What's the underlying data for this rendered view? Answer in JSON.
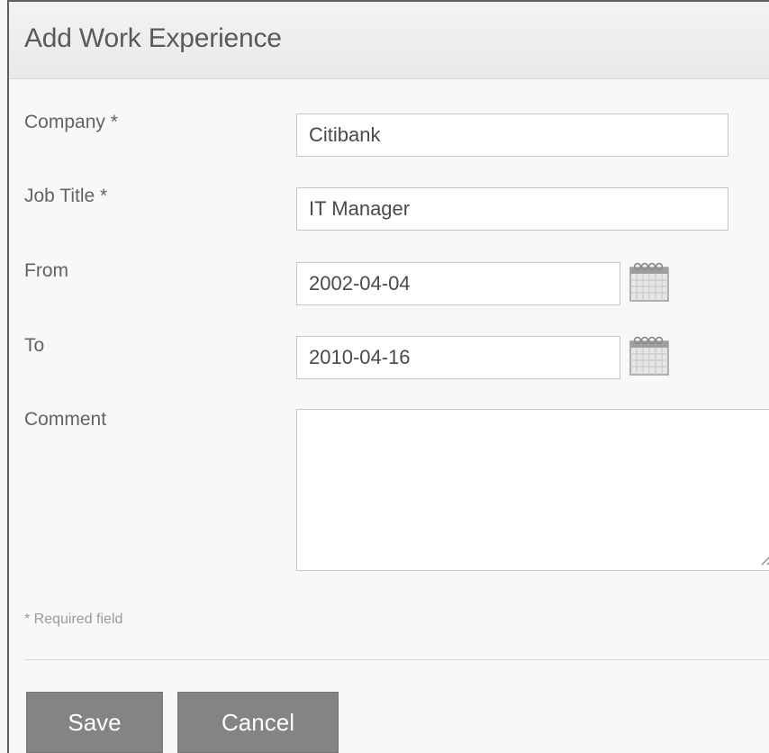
{
  "dialog": {
    "title": "Add Work Experience"
  },
  "form": {
    "company": {
      "label": "Company *",
      "value": "Citibank"
    },
    "job_title": {
      "label": "Job Title *",
      "value": "IT Manager"
    },
    "from": {
      "label": "From",
      "value": "2002-04-04",
      "icon": "calendar-icon"
    },
    "to": {
      "label": "To",
      "value": "2010-04-16",
      "icon": "calendar-icon"
    },
    "comment": {
      "label": "Comment",
      "value": ""
    },
    "required_note": "* Required field"
  },
  "buttons": {
    "save": "Save",
    "cancel": "Cancel"
  },
  "colors": {
    "button_bg": "#848484",
    "header_bg": "#efefef",
    "label_text": "#636363"
  }
}
